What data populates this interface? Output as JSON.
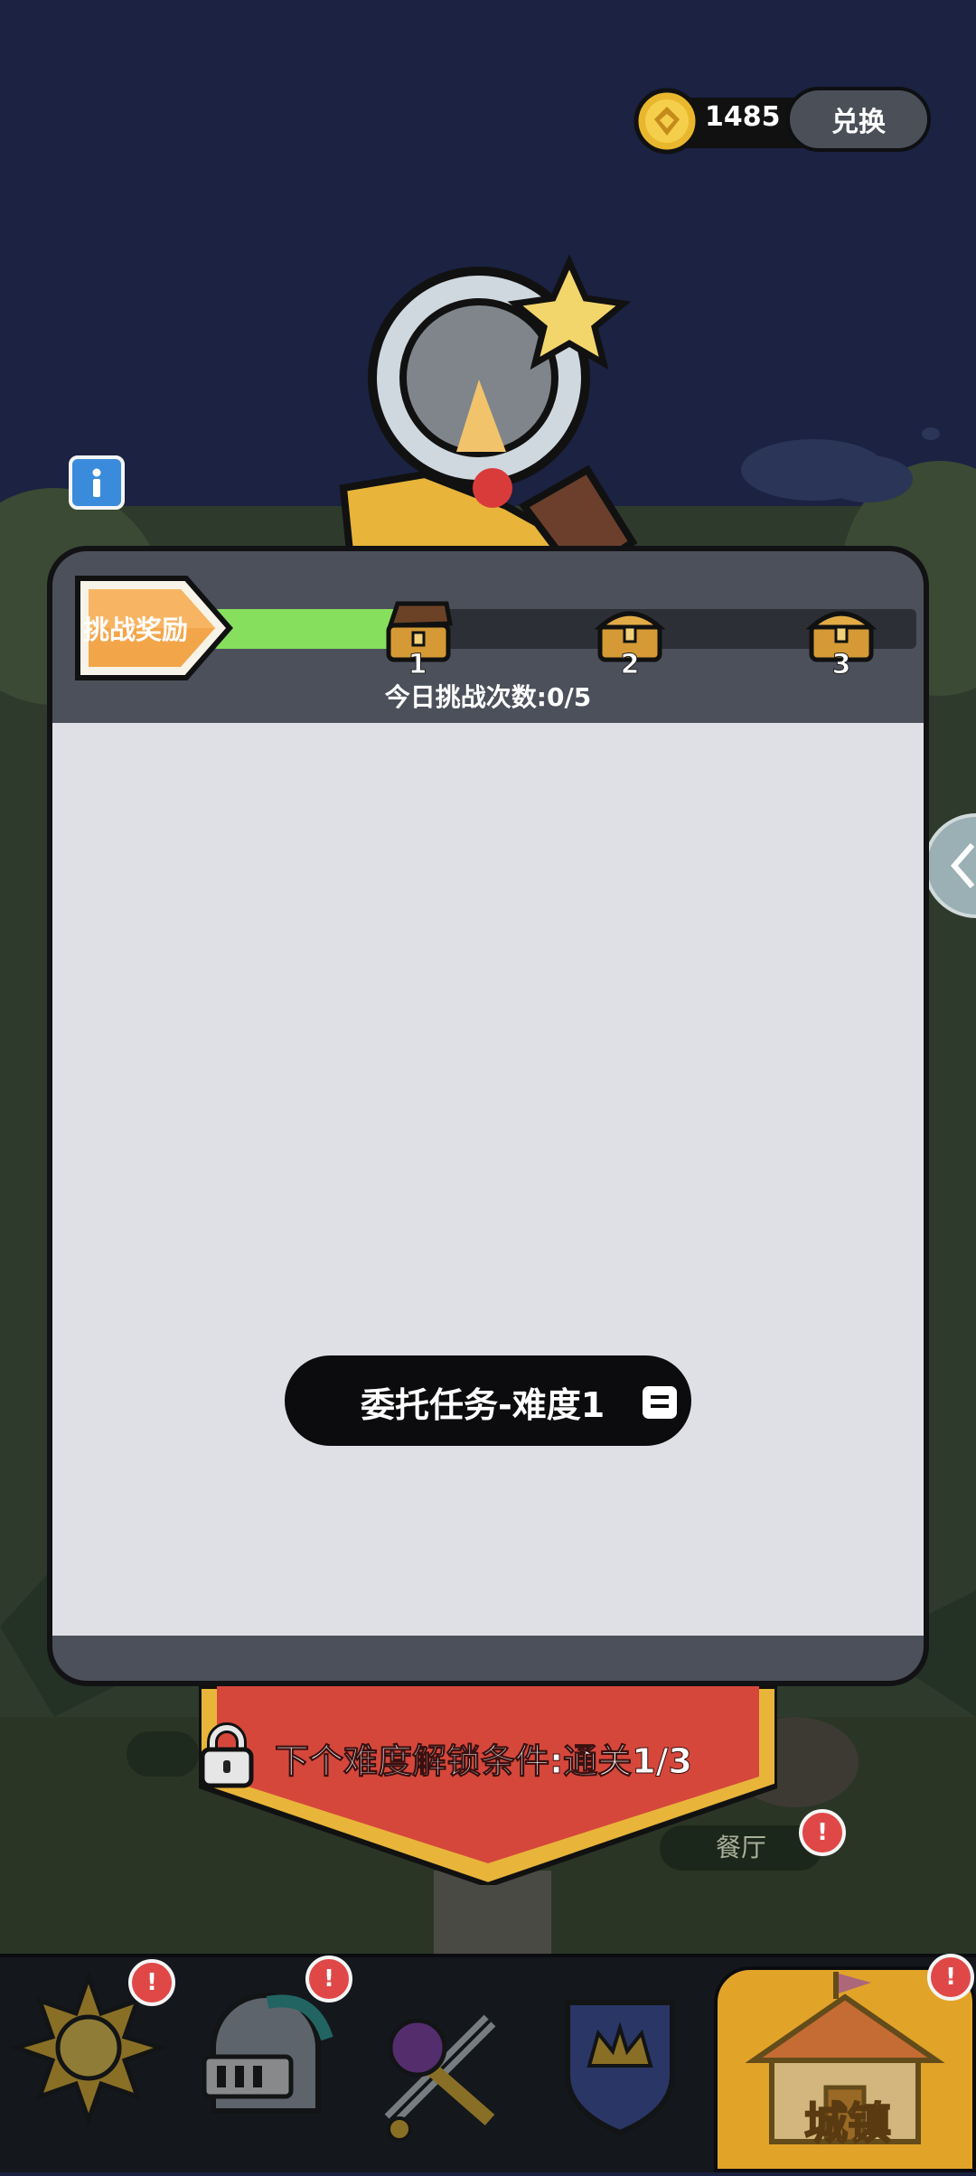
{
  "currency": {
    "icon": "gold-coin-icon",
    "amount": "1485",
    "exchange_label": "兑换"
  },
  "info_button": {
    "icon": "info-icon"
  },
  "reward_panel": {
    "label": "挑战奖励",
    "progress_fraction": 0.33,
    "chests": [
      {
        "icon": "treasure-chest-icon",
        "number": "1",
        "opened": true
      },
      {
        "icon": "treasure-chest-icon",
        "number": "2",
        "opened": false
      },
      {
        "icon": "treasure-chest-icon",
        "number": "3",
        "opened": false
      }
    ],
    "daily_count": "今日挑战次数:0/5"
  },
  "task": {
    "title": "委托任务-难度1",
    "icon": "document-icon"
  },
  "unlock": {
    "icon": "lock-icon",
    "text": "下个难度解锁条件:通关1/3"
  },
  "map_labels": {
    "restaurant": "餐厅"
  },
  "bottom_nav": {
    "items": [
      {
        "icon": "sun-icon",
        "badge": "!"
      },
      {
        "icon": "knight-helmet-icon",
        "badge": "!"
      },
      {
        "icon": "weapons-icon",
        "badge": "!"
      },
      {
        "icon": "guild-crown-shield-icon"
      },
      {
        "icon": "town-house-icon",
        "label": "城镇",
        "badge": "!"
      }
    ]
  },
  "colors": {
    "accent_orange": "#f3a54a",
    "progress_green": "#86e05d",
    "banner_red": "#d6473b",
    "nav_active": "#e1a428"
  }
}
